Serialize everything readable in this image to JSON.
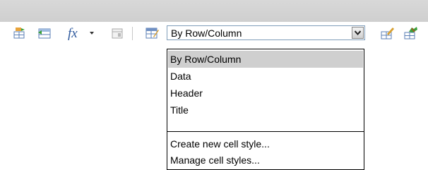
{
  "toolbar": {
    "icons": [
      "insert-row-icon",
      "insert-column-icon",
      "function-icon",
      "field-icon",
      "cell-style-icon",
      "edit-attribute-icon",
      "match-cell-icon"
    ],
    "formula_symbol": "fx",
    "cell_style_combo": {
      "selected": "By Row/Column"
    }
  },
  "dropdown": {
    "options": [
      "By Row/Column",
      "Data",
      "Header",
      "Title"
    ],
    "actions": [
      "Create new cell style...",
      "Manage cell styles..."
    ],
    "selected_index": 0
  },
  "colors": {
    "toolbar_strip": "#d3d3d3",
    "selection_highlight": "#cfcfcf",
    "combo_border": "#7f9db9"
  }
}
